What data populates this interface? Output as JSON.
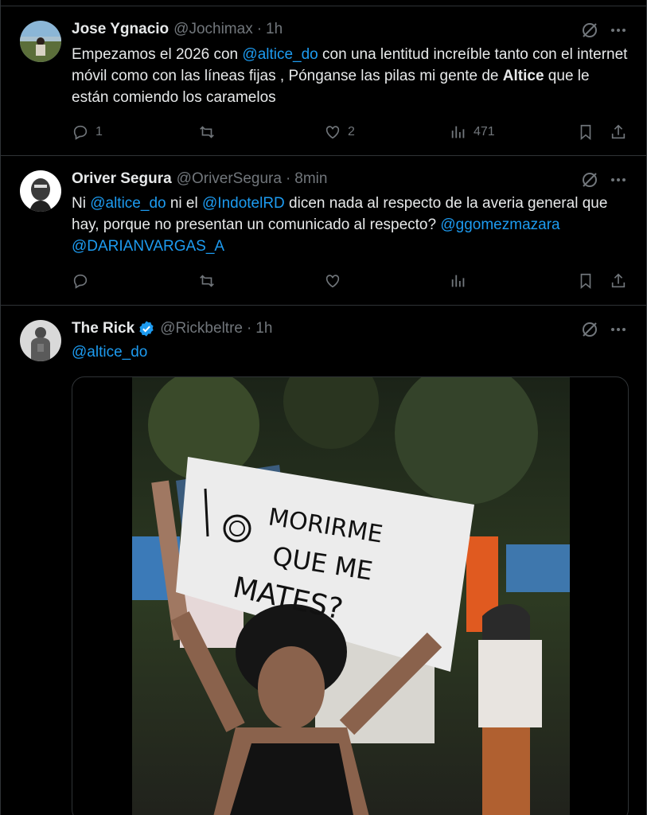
{
  "tweets": [
    {
      "name": "Jose Ygnacio",
      "handle": "@Jochimax",
      "time": "1h",
      "text": [
        {
          "t": "Empezamos el 2026 con ",
          "k": "plain"
        },
        {
          "t": "@altice_do",
          "k": "mention"
        },
        {
          "t": " con una lentitud increíble tanto con el internet móvil como con las líneas fijas , Pónganse las pilas mi gente de ",
          "k": "plain"
        },
        {
          "t": "Altice",
          "k": "bold"
        },
        {
          "t": " que le están comiendo los caramelos",
          "k": "plain"
        }
      ],
      "replies": "1",
      "reposts": "",
      "likes": "2",
      "views": "471"
    },
    {
      "name": "Oriver Segura",
      "handle": "@OriverSegura",
      "time": "8min",
      "text": [
        {
          "t": "Ni ",
          "k": "plain"
        },
        {
          "t": "@altice_do",
          "k": "mention"
        },
        {
          "t": " ni el ",
          "k": "plain"
        },
        {
          "t": "@IndotelRD",
          "k": "mention"
        },
        {
          "t": " dicen nada al respecto de la averia general que hay, porque no presentan un comunicado al respecto? ",
          "k": "plain"
        },
        {
          "t": "@ggomezmazara",
          "k": "mention"
        },
        {
          "t": " ",
          "k": "plain"
        },
        {
          "t": "@DARIANVARGAS_A",
          "k": "mention"
        }
      ],
      "replies": "",
      "reposts": "",
      "likes": "",
      "views": ""
    },
    {
      "name": "The Rick",
      "handle": "@Rickbeltre",
      "time": "1h",
      "verified": true,
      "text": [
        {
          "t": "@altice_do",
          "k": "mention"
        }
      ],
      "sign_text": [
        "MORIRME",
        "QUE ME",
        "MATES?"
      ]
    }
  ],
  "icons": [
    "grok-icon",
    "more-icon",
    "reply-icon",
    "repost-icon",
    "like-icon",
    "views-icon",
    "bookmark-icon",
    "share-icon",
    "verified-icon"
  ],
  "colors": {
    "background": "#000000",
    "text": "#e7e9ea",
    "muted": "#71767b",
    "accent": "#1d9bf0",
    "border": "#2f3336"
  }
}
